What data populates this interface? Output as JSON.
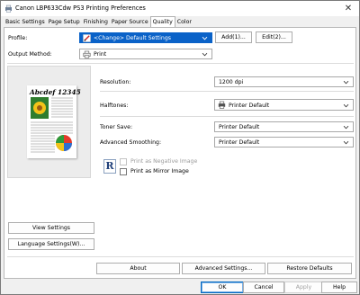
{
  "window": {
    "title": "Canon LBP633Cdw PS3 Printing Preferences",
    "close_glyph": "✕"
  },
  "tabs": [
    {
      "label": "Basic Settings",
      "active": false
    },
    {
      "label": "Page Setup",
      "active": false
    },
    {
      "label": "Finishing",
      "active": false
    },
    {
      "label": "Paper Source",
      "active": false
    },
    {
      "label": "Quality",
      "active": true
    },
    {
      "label": "Color",
      "active": false
    }
  ],
  "profile": {
    "label": "Profile:",
    "value": "<Change> Default Settings",
    "icon": "profile-pencil-icon",
    "add_label": "Add(1)...",
    "edit_label": "Edit(2)..."
  },
  "output_method": {
    "label": "Output Method:",
    "value": "Print",
    "icon": "printer-icon"
  },
  "settings": {
    "resolution_label": "Resolution:",
    "resolution_value": "1200 dpi",
    "halftones_label": "Halftones:",
    "halftones_value": "Printer Default",
    "toner_save_label": "Toner Save:",
    "toner_save_value": "Printer Default",
    "advanced_smoothing_label": "Advanced Smoothing:",
    "advanced_smoothing_value": "Printer Default",
    "negative_image_label": "Print as Negative Image",
    "negative_image_checked": false,
    "negative_image_enabled": false,
    "mirror_image_label": "Print as Mirror Image",
    "mirror_image_checked": false,
    "mirror_icon_letter": "R"
  },
  "preview": {
    "sample_text": "Abcdef 12345"
  },
  "left_buttons": {
    "view_settings": "View Settings",
    "language_settings": "Language Settings(W)..."
  },
  "bottom_buttons": {
    "about": "About",
    "advanced_settings": "Advanced Settings...",
    "restore_defaults": "Restore Defaults"
  },
  "dialog_buttons": {
    "ok": "OK",
    "cancel": "Cancel",
    "apply": "Apply",
    "help": "Help"
  },
  "colors": {
    "selection_blue": "#0a62c8",
    "accent_border": "#0067c0"
  }
}
